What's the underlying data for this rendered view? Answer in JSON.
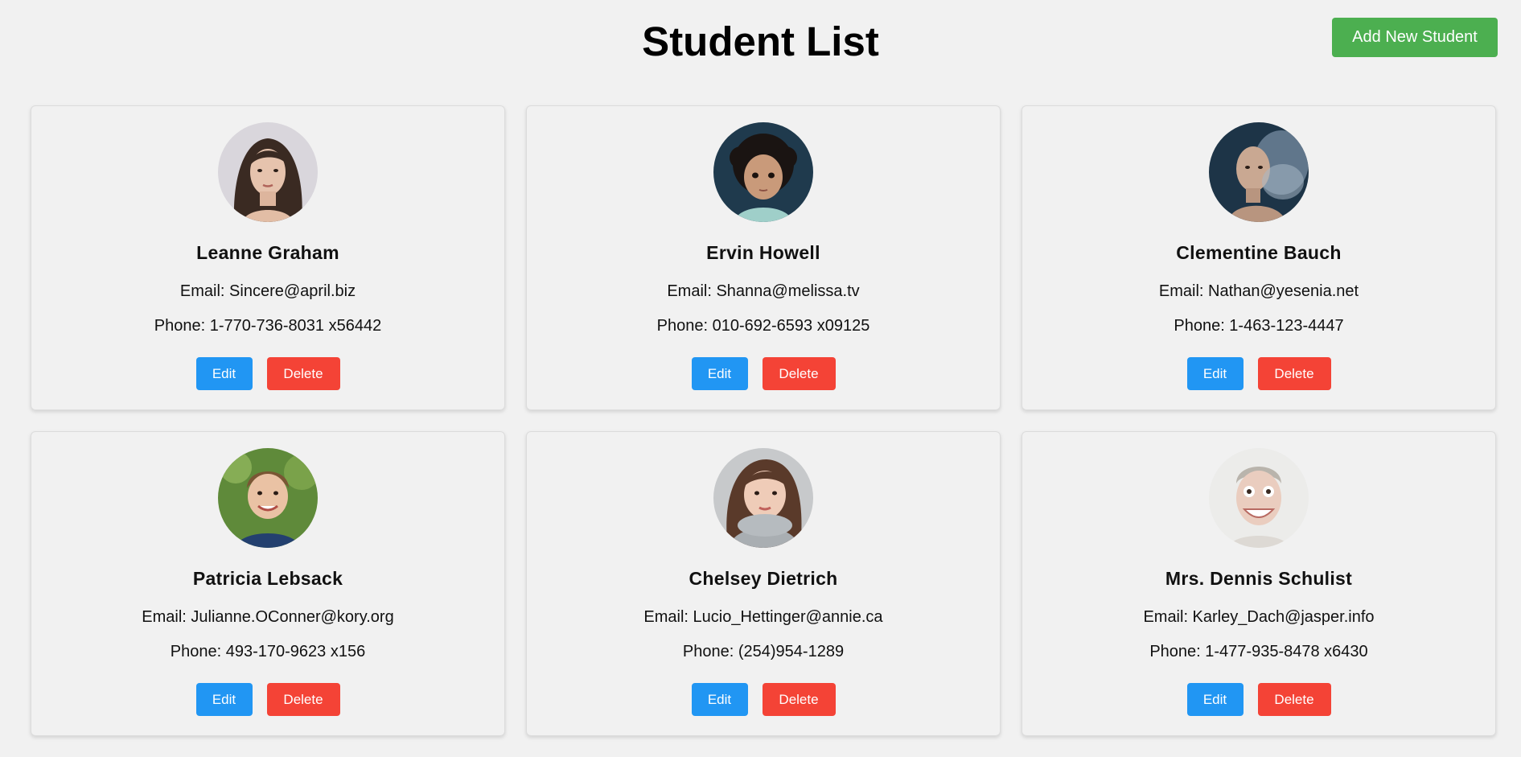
{
  "header": {
    "title": "Student List",
    "add_button_label": "Add New Student",
    "add_button_color": "#4caf50"
  },
  "colors": {
    "edit": "#2196f3",
    "delete": "#f44336",
    "background": "#f1f1f1"
  },
  "students": [
    {
      "name": "Leanne Graham",
      "email": "Email: Sincere@april.biz",
      "phone": "Phone: 1-770-736-8031 x56442",
      "edit_label": "Edit",
      "delete_label": "Delete",
      "avatar": "avatar-woman-long-hair"
    },
    {
      "name": "Ervin Howell",
      "email": "Email: Shanna@melissa.tv",
      "phone": "Phone: 010-692-6593 x09125",
      "edit_label": "Edit",
      "delete_label": "Delete",
      "avatar": "avatar-curly-haired-child"
    },
    {
      "name": "Clementine Bauch",
      "email": "Email: Nathan@yesenia.net",
      "phone": "Phone: 1-463-123-4447",
      "edit_label": "Edit",
      "delete_label": "Delete",
      "avatar": "avatar-bald-man-smoke"
    },
    {
      "name": "Patricia Lebsack",
      "email": "Email: Julianne.OConner@kory.org",
      "phone": "Phone: 493-170-9623 x156",
      "edit_label": "Edit",
      "delete_label": "Delete",
      "avatar": "avatar-smiling-boy"
    },
    {
      "name": "Chelsey Dietrich",
      "email": "Email: Lucio_Hettinger@annie.ca",
      "phone": "Phone: (254)954-1289",
      "edit_label": "Edit",
      "delete_label": "Delete",
      "avatar": "avatar-woman-scarf"
    },
    {
      "name": "Mrs. Dennis Schulist",
      "email": "Email: Karley_Dach@jasper.info",
      "phone": "Phone: 1-477-935-8478 x6430",
      "edit_label": "Edit",
      "delete_label": "Delete",
      "avatar": "avatar-grinning-man"
    }
  ]
}
